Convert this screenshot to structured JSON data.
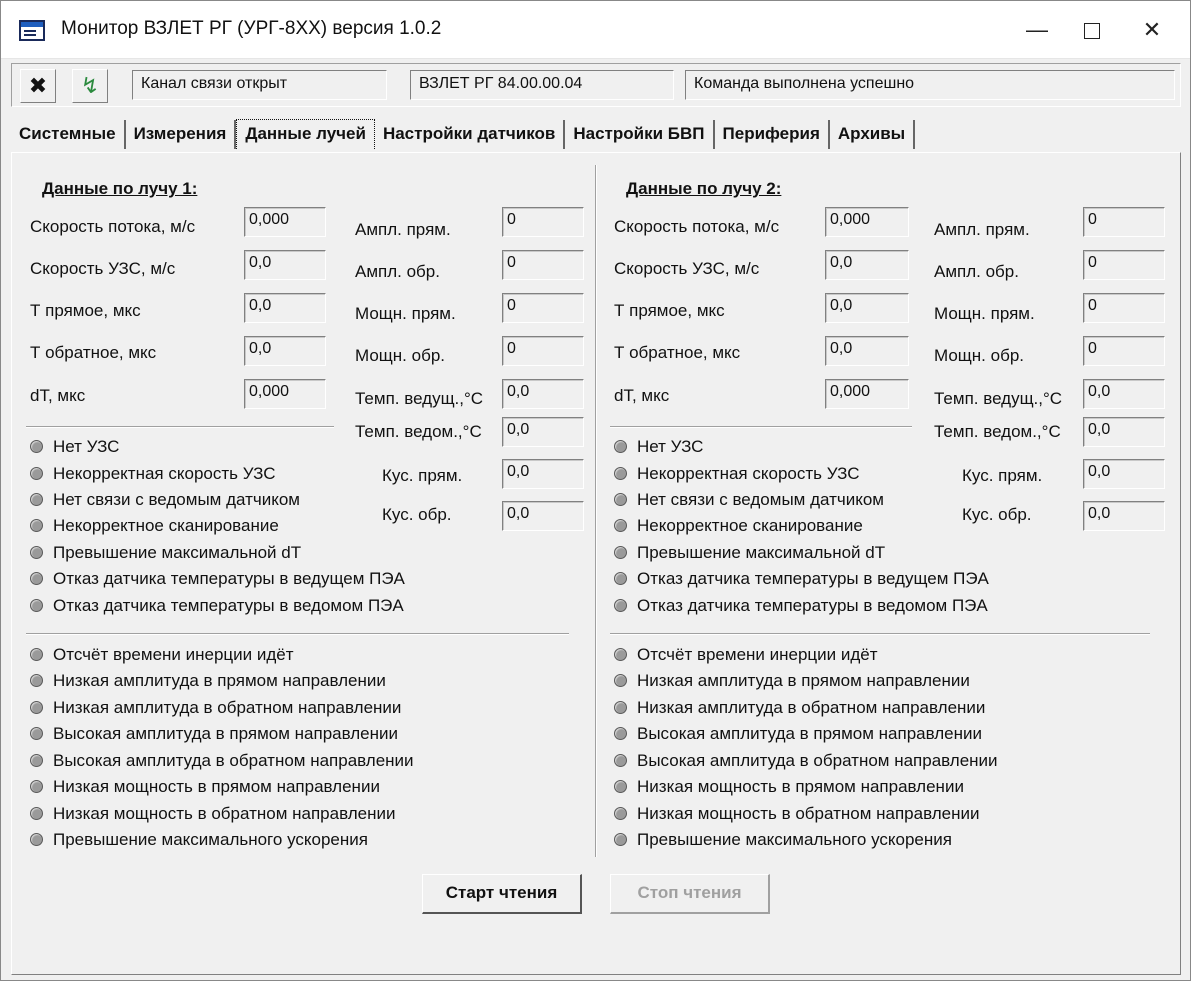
{
  "window": {
    "title": "Монитор ВЗЛЕТ РГ (УРГ-8XX) версия 1.0.2",
    "minimize": "—",
    "close": "✕"
  },
  "toolbar": {
    "disconnect_icon": "✖",
    "connect_icon": "↯",
    "channel_status": "Канал связи открыт",
    "device_id": "ВЗЛЕТ РГ 84.00.00.04",
    "command_status": "Команда выполнена успешно"
  },
  "tabs": [
    {
      "label": "Системные",
      "active": false
    },
    {
      "label": "Измерения",
      "active": false
    },
    {
      "label": "Данные лучей",
      "active": true
    },
    {
      "label": "Настройки датчиков",
      "active": false
    },
    {
      "label": "Настройки БВП",
      "active": false
    },
    {
      "label": "Периферия",
      "active": false
    },
    {
      "label": "Архивы",
      "active": false
    }
  ],
  "beam1": {
    "title": "Данные по лучу 1:",
    "left_fields": [
      {
        "label": "Скорость потока, м/с",
        "value": "0,000"
      },
      {
        "label": "Скорость УЗС, м/с",
        "value": "0,0"
      },
      {
        "label": "Т прямое, мкс",
        "value": "0,0"
      },
      {
        "label": "Т обратное, мкс",
        "value": "0,0"
      },
      {
        "label": "dT, мкс",
        "value": "0,000"
      }
    ],
    "right_fields": [
      {
        "label": "Ампл. прям.",
        "value": "0"
      },
      {
        "label": "Ампл. обр.",
        "value": "0"
      },
      {
        "label": "Мощн. прям.",
        "value": "0"
      },
      {
        "label": "Мощн. обр.",
        "value": "0"
      },
      {
        "label": "Темп. ведущ.,°C",
        "value": "0,0"
      },
      {
        "label": "Темп. ведом.,°C",
        "value": "0,0"
      },
      {
        "label": "Кус. прям.",
        "value": "0,0"
      },
      {
        "label": "Кус. обр.",
        "value": "0,0"
      }
    ],
    "flags_a": [
      "Нет УЗС",
      "Некорректная скорость УЗС",
      "Нет связи с ведомым датчиком",
      "Некорректное сканирование",
      "Превышение максимальной dT",
      "Отказ датчика температуры в ведущем ПЭА",
      "Отказ датчика температуры в ведомом ПЭА"
    ],
    "flags_b": [
      "Отсчёт времени инерции идёт",
      "Низкая амплитуда в прямом направлении",
      "Низкая амплитуда в обратном направлении",
      "Высокая амплитуда в прямом направлении",
      "Высокая амплитуда в обратном направлении",
      "Низкая мощность в прямом направлении",
      "Низкая мощность в обратном направлении",
      "Превышение максимального ускорения"
    ]
  },
  "beam2": {
    "title": "Данные по лучу 2:",
    "left_fields": [
      {
        "label": "Скорость потока, м/с",
        "value": "0,000"
      },
      {
        "label": "Скорость УЗС, м/с",
        "value": "0,0"
      },
      {
        "label": "Т прямое, мкс",
        "value": "0,0"
      },
      {
        "label": "Т обратное, мкс",
        "value": "0,0"
      },
      {
        "label": "dT, мкс",
        "value": "0,000"
      }
    ],
    "right_fields": [
      {
        "label": "Ампл. прям.",
        "value": "0"
      },
      {
        "label": "Ампл. обр.",
        "value": "0"
      },
      {
        "label": "Мощн. прям.",
        "value": "0"
      },
      {
        "label": "Мощн. обр.",
        "value": "0"
      },
      {
        "label": "Темп. ведущ.,°C",
        "value": "0,0"
      },
      {
        "label": "Темп. ведом.,°C",
        "value": "0,0"
      },
      {
        "label": "Кус. прям.",
        "value": "0,0"
      },
      {
        "label": "Кус. обр.",
        "value": "0,0"
      }
    ],
    "flags_a": [
      "Нет УЗС",
      "Некорректная скорость УЗС",
      "Нет связи с ведомым датчиком",
      "Некорректное сканирование",
      "Превышение максимальной dT",
      "Отказ датчика температуры в ведущем ПЭА",
      "Отказ датчика температуры в ведомом ПЭА"
    ],
    "flags_b": [
      "Отсчёт времени инерции идёт",
      "Низкая амплитуда в прямом направлении",
      "Низкая амплитуда в обратном направлении",
      "Высокая амплитуда в прямом направлении",
      "Высокая амплитуда в обратном направлении",
      "Низкая мощность в прямом направлении",
      "Низкая мощность в обратном направлении",
      "Превышение максимального ускорения"
    ]
  },
  "actions": {
    "start_label": "Старт чтения",
    "stop_label": "Стоп чтения"
  }
}
